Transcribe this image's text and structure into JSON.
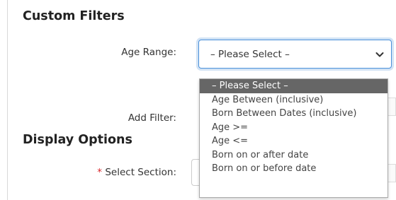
{
  "custom_filters": {
    "heading": "Custom Filters",
    "age_range_label": "Age Range:",
    "age_range_value": "– Please Select –",
    "add_filter_label": "Add Filter:"
  },
  "dropdown": {
    "options": [
      {
        "label": "– Please Select –",
        "selected": true
      },
      {
        "label": "Age Between (inclusive)",
        "selected": false
      },
      {
        "label": "Born Between Dates (inclusive)",
        "selected": false
      },
      {
        "label": "Age >=",
        "selected": false
      },
      {
        "label": "Age <=",
        "selected": false
      },
      {
        "label": "Born on or after date",
        "selected": false
      },
      {
        "label": "Born on or before date",
        "selected": false
      }
    ]
  },
  "display_options": {
    "heading": "Display Options",
    "required_marker": "*",
    "select_section_label": "Select Section:"
  },
  "icons": {
    "select_arrow": "chevron-down-icon"
  },
  "colors": {
    "focus_border": "#4a90d9",
    "selected_option_bg": "#666666",
    "required_star": "#d9262a"
  }
}
